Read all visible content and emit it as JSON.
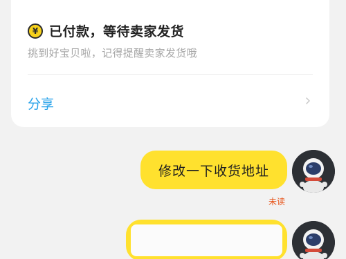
{
  "order_card": {
    "status_icon": "yen-coin-icon",
    "status_icon_glyph": "¥",
    "status_title": "已付款，等待卖家发货",
    "status_subtitle": "挑到好宝贝啦，记得提醒卖家发货哦",
    "share_label": "分享",
    "chevron": "chevron-right-icon"
  },
  "messages": [
    {
      "text": "修改一下收货地址",
      "status": "未读",
      "avatar": "astronaut-avatar"
    },
    {
      "text": "",
      "avatar": "astronaut-avatar"
    }
  ],
  "colors": {
    "bubble": "#ffe12e",
    "link": "#29a3ea",
    "unread": "#e8541a",
    "background": "#f2f2f2"
  }
}
